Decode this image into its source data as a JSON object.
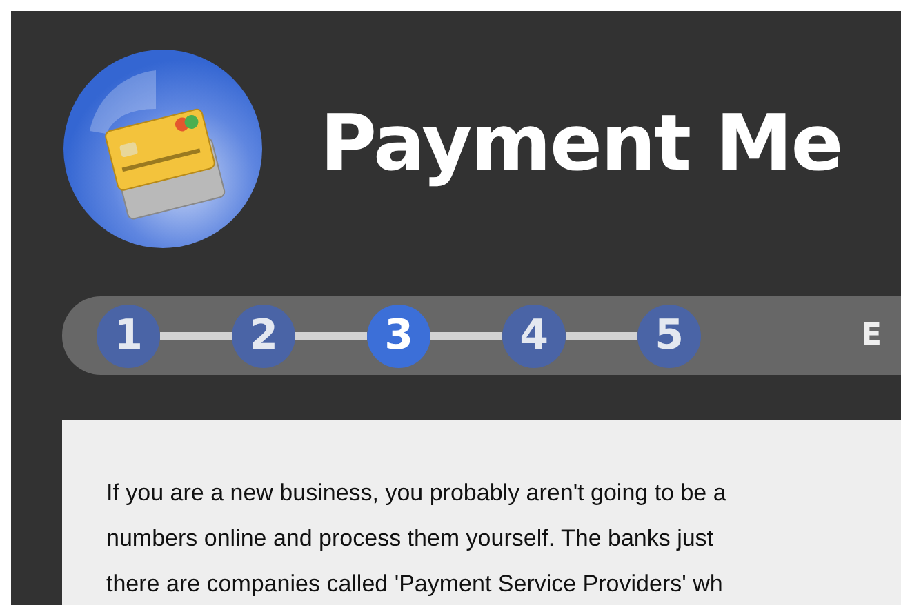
{
  "title": "Payment Me",
  "steps": [
    {
      "label": "1",
      "selected": false
    },
    {
      "label": "2",
      "selected": false
    },
    {
      "label": "3",
      "selected": true
    },
    {
      "label": "4",
      "selected": false
    },
    {
      "label": "5",
      "selected": false
    }
  ],
  "step_bar_label": "E",
  "paragraph_lines": [
    "If you are a new business, you probably aren't going to be a",
    "numbers online and process them yourself. The banks just",
    "there are companies called 'Payment Service Providers' wh"
  ]
}
